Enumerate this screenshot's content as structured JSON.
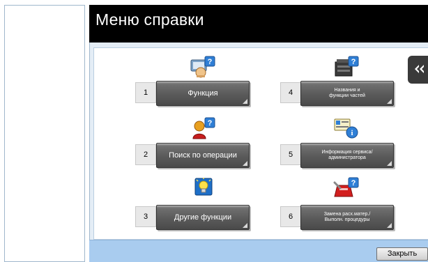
{
  "window": {
    "title": "Меню справки"
  },
  "items": [
    {
      "number": "1",
      "label": "Функция",
      "icon": "function-help-icon"
    },
    {
      "number": "2",
      "label": "Поиск по операции",
      "icon": "operation-search-icon"
    },
    {
      "number": "3",
      "label": "Другие функции",
      "icon": "other-functions-icon"
    },
    {
      "number": "4",
      "label_line1": "Названия и",
      "label_line2": "функции частей",
      "icon": "parts-names-icon"
    },
    {
      "number": "5",
      "label_line1": "Информация сервиса/",
      "label_line2": "администратора",
      "icon": "service-admin-info-icon"
    },
    {
      "number": "6",
      "label_line1": "Замена расх.матер./",
      "label_line2": "Выполн. процедуры",
      "icon": "consumables-replace-icon"
    }
  ],
  "footer": {
    "close_label": "Закрыть"
  },
  "side_tab": {
    "icon": "double-chevron-left-icon"
  },
  "colors": {
    "title_bg": "#000000",
    "frame_bg": "#e4edf6",
    "bottom_bar": "#a9ccef",
    "button_gray": "#5a5a5a"
  }
}
